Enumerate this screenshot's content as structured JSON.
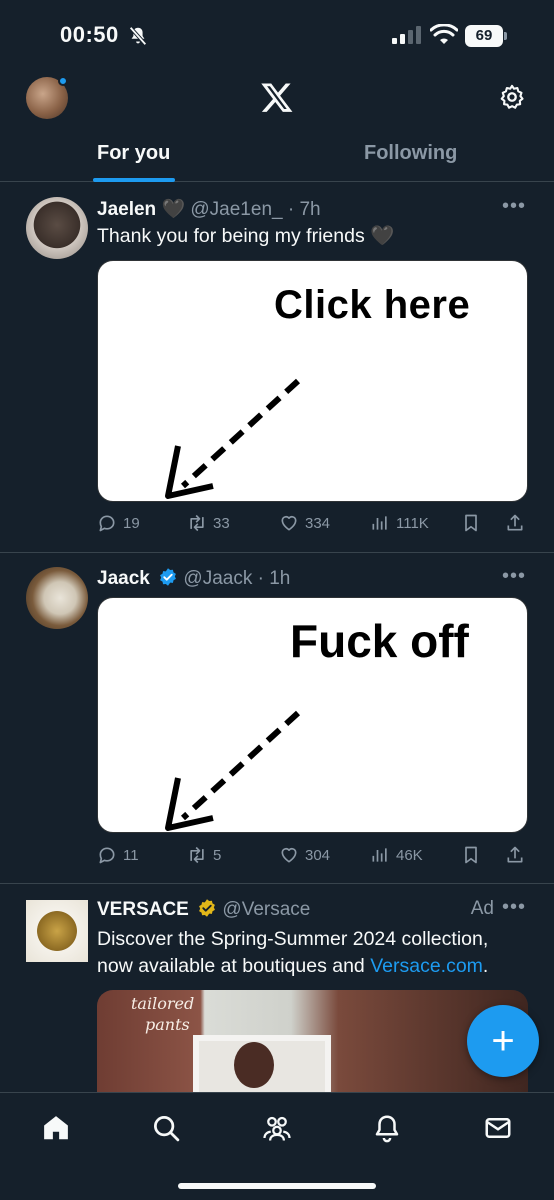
{
  "status_bar": {
    "time": "00:50",
    "battery": "69"
  },
  "header": {
    "tabs": [
      {
        "label": "For you",
        "active": true
      },
      {
        "label": "Following",
        "active": false
      }
    ]
  },
  "tweets": [
    {
      "name": "Jaelen",
      "name_emoji": "🖤",
      "handle": "@Jae1en_",
      "separator": "·",
      "time": "7h",
      "text": "Thank you for being my friends 🖤",
      "media_text": "Click here",
      "stats": {
        "replies": "19",
        "retweets": "33",
        "likes": "334",
        "views": "111K"
      }
    },
    {
      "name": "Jaack",
      "verified": "blue",
      "handle": "@Jaack",
      "separator": "·",
      "time": "1h",
      "media_text": "Fuck off",
      "stats": {
        "replies": "11",
        "retweets": "5",
        "likes": "304",
        "views": "46K"
      }
    },
    {
      "name": "VERSACE",
      "verified": "gold",
      "handle": "@Versace",
      "ad_label": "Ad",
      "text_before_link": "Discover the Spring-Summer 2024 collection, now available at boutiques and ",
      "link_text": "Versace.com",
      "text_after_link": ".",
      "media_script_1": "tailored",
      "media_script_2": "pants"
    }
  ],
  "fab": {
    "label": "+"
  },
  "colors": {
    "background": "#15202b",
    "accent": "#1d9bf0",
    "muted": "#8b98a5",
    "gold": "#e2b719"
  },
  "icons": [
    "bell-off-icon",
    "signal-icon",
    "wifi-icon",
    "battery-icon",
    "x-logo-icon",
    "gear-icon",
    "more-icon",
    "reply-icon",
    "retweet-icon",
    "like-icon",
    "views-icon",
    "bookmark-icon",
    "share-icon",
    "verified-icon",
    "home-icon",
    "search-icon",
    "communities-icon",
    "notifications-icon",
    "messages-icon"
  ]
}
